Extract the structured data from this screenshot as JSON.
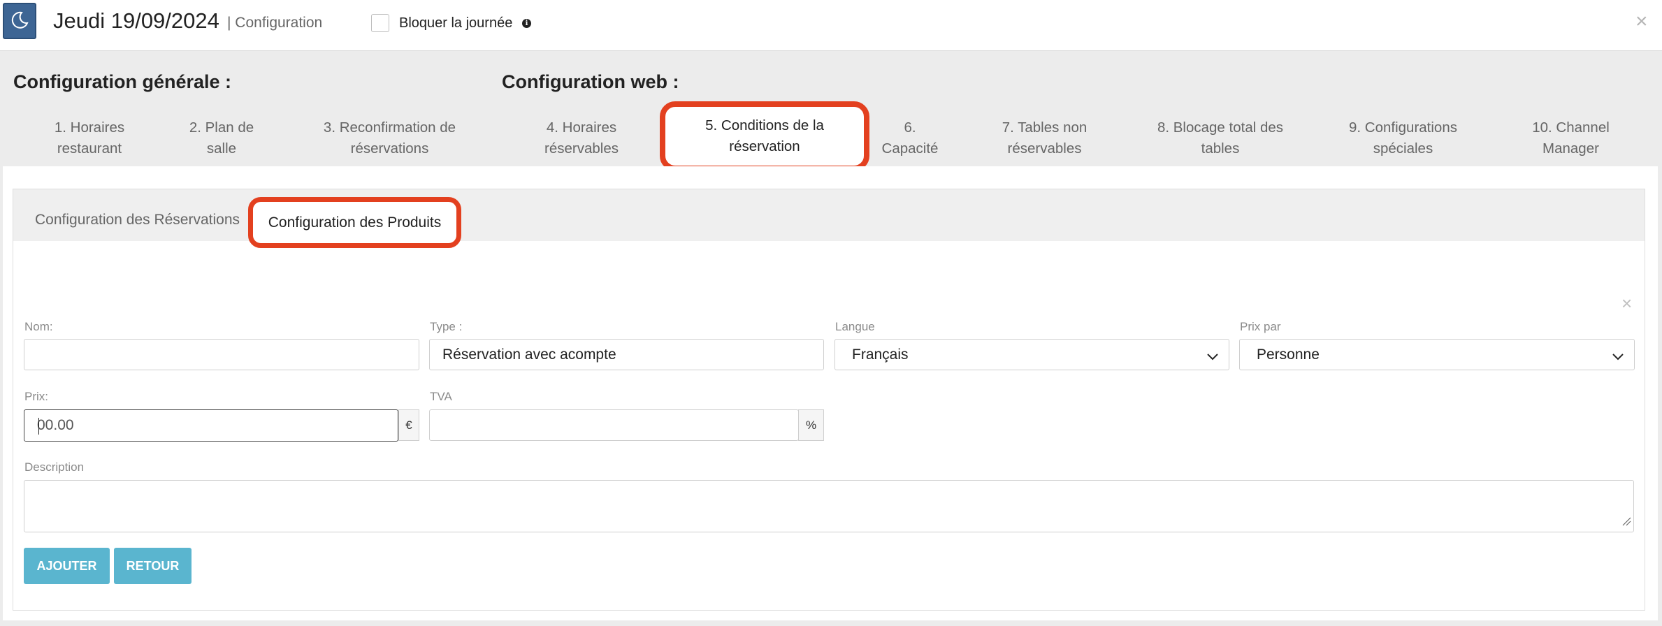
{
  "header": {
    "moon_icon": "moon-icon",
    "title": "Jeudi 19/09/2024",
    "subtitle": "| Configuration",
    "block_day_label": "Bloquer la journée",
    "block_day_checked": false,
    "info_icon": "i",
    "close": "×"
  },
  "sections": {
    "general": "Configuration générale :",
    "web": "Configuration web :"
  },
  "tabs": [
    {
      "line1": "1. Horaires",
      "line2": "restaurant"
    },
    {
      "line1": "2. Plan de",
      "line2": "salle"
    },
    {
      "line1": "3. Reconfirmation de",
      "line2": "réservations"
    },
    {
      "line1": "4. Horaires",
      "line2": "réservables"
    },
    {
      "line1": "5. Conditions de la",
      "line2": "réservation",
      "active": true
    },
    {
      "line1": "6.",
      "line2": "Capacité"
    },
    {
      "line1": "7. Tables non",
      "line2": "réservables"
    },
    {
      "line1": "8. Blocage total des",
      "line2": "tables"
    },
    {
      "line1": "9. Configurations",
      "line2": "spéciales"
    },
    {
      "line1": "10. Channel",
      "line2": "Manager"
    }
  ],
  "subtabs": {
    "reservations": "Configuration des Réservations",
    "products": "Configuration des Produits"
  },
  "form": {
    "close": "×",
    "nom": {
      "label": "Nom:",
      "value": ""
    },
    "type": {
      "label": "Type :",
      "value": "Réservation avec acompte"
    },
    "langue": {
      "label": "Langue",
      "value": "Français"
    },
    "prix_par": {
      "label": "Prix par",
      "value": "Personne"
    },
    "prix": {
      "label": "Prix:",
      "placeholder": "00.00",
      "currency": "€"
    },
    "tva": {
      "label": "TVA",
      "value": "",
      "unit": "%"
    },
    "description": {
      "label": "Description",
      "value": ""
    }
  },
  "buttons": {
    "add": "AJOUTER",
    "back": "RETOUR"
  },
  "colors": {
    "accent_button": "#5ab5cf",
    "highlight": "#e3401f",
    "moon_button": "#3d6594"
  }
}
